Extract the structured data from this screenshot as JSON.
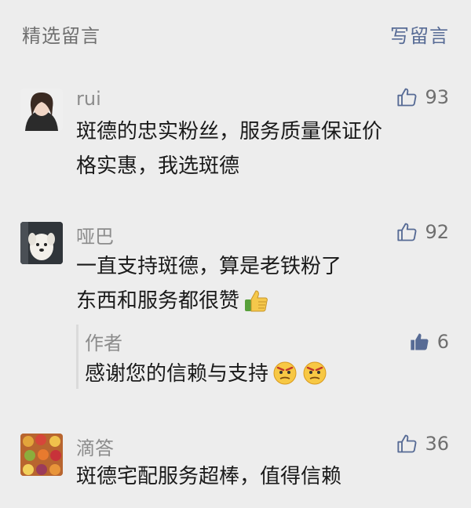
{
  "header": {
    "title": "精选留言",
    "write_label": "写留言"
  },
  "comments": [
    {
      "name": "rui",
      "likes": "93",
      "lines": [
        "斑德的忠实粉丝，服务质量保证价",
        "格实惠，我选斑德"
      ]
    },
    {
      "name": "哑巴",
      "likes": "92",
      "lines": [
        "一直支持斑德，算是老铁粉了",
        "东西和服务都很赞"
      ],
      "reply": {
        "author_label": "作者",
        "likes": "6",
        "text": "感谢您的信赖与支持"
      }
    },
    {
      "name": "滴答",
      "likes": "36",
      "lines": [
        "斑德宅配服务超棒，值得信赖"
      ]
    }
  ],
  "colors": {
    "link": "#576b95",
    "like_filled": "#576b95"
  }
}
